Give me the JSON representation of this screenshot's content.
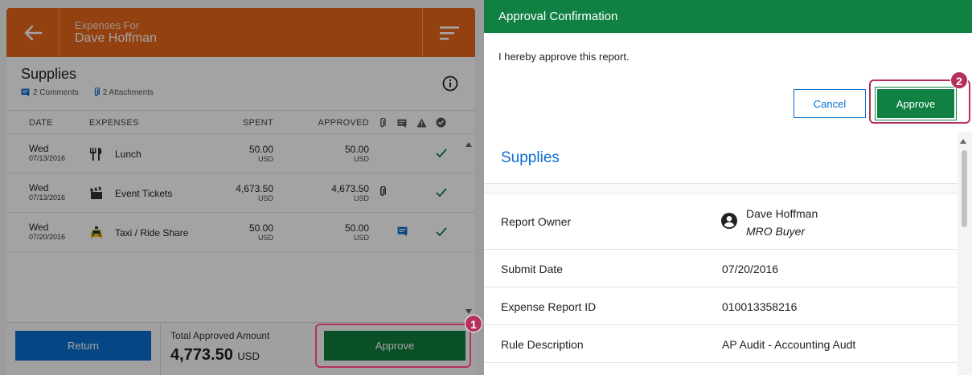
{
  "header": {
    "subtitle": "Expenses For",
    "name": "Dave Hoffman"
  },
  "report": {
    "title": "Supplies",
    "comments": "2 Comments",
    "attachments": "2 Attachments"
  },
  "columns": {
    "date": "DATE",
    "expenses": "EXPENSES",
    "spent": "SPENT",
    "approved": "APPROVED"
  },
  "rows": [
    {
      "day": "Wed",
      "date": "07/13/2016",
      "icon": "cutlery-icon",
      "expense": "Lunch",
      "spent": "50.00",
      "spent_currency": "USD",
      "approved": "50.00",
      "approved_currency": "USD",
      "has_attachment": false,
      "has_comment": false
    },
    {
      "day": "Wed",
      "date": "07/13/2016",
      "icon": "clapperboard-icon",
      "expense": "Event Tickets",
      "spent": "4,673.50",
      "spent_currency": "USD",
      "approved": "4,673.50",
      "approved_currency": "USD",
      "has_attachment": true,
      "has_comment": false
    },
    {
      "day": "Wed",
      "date": "07/20/2016",
      "icon": "taxi-icon",
      "expense": "Taxi / Ride Share",
      "spent": "50.00",
      "spent_currency": "USD",
      "approved": "50.00",
      "approved_currency": "USD",
      "has_attachment": false,
      "has_comment": true
    }
  ],
  "footer": {
    "return_label": "Return",
    "total_label": "Total Approved Amount",
    "total_value": "4,773.50",
    "total_currency": "USD",
    "approve_label": "Approve"
  },
  "callouts": {
    "first": "1",
    "second": "2"
  },
  "dialog": {
    "title": "Approval Confirmation",
    "message": "I hereby approve this report.",
    "cancel_label": "Cancel",
    "approve_label": "Approve"
  },
  "details": {
    "title": "Supplies",
    "owner_label": "Report Owner",
    "owner_name": "Dave Hoffman",
    "owner_role": "MRO Buyer",
    "submit_label": "Submit Date",
    "submit_value": "07/20/2016",
    "id_label": "Expense Report ID",
    "id_value": "010013358216",
    "rule_label": "Rule Description",
    "rule_value": "AP Audit - Accounting Audt"
  },
  "colors": {
    "header_orange": "#e8671d",
    "approve_green": "#107e3e",
    "dialog_green": "#108043",
    "return_blue": "#0a6ed1",
    "callout": "#b5305a"
  }
}
